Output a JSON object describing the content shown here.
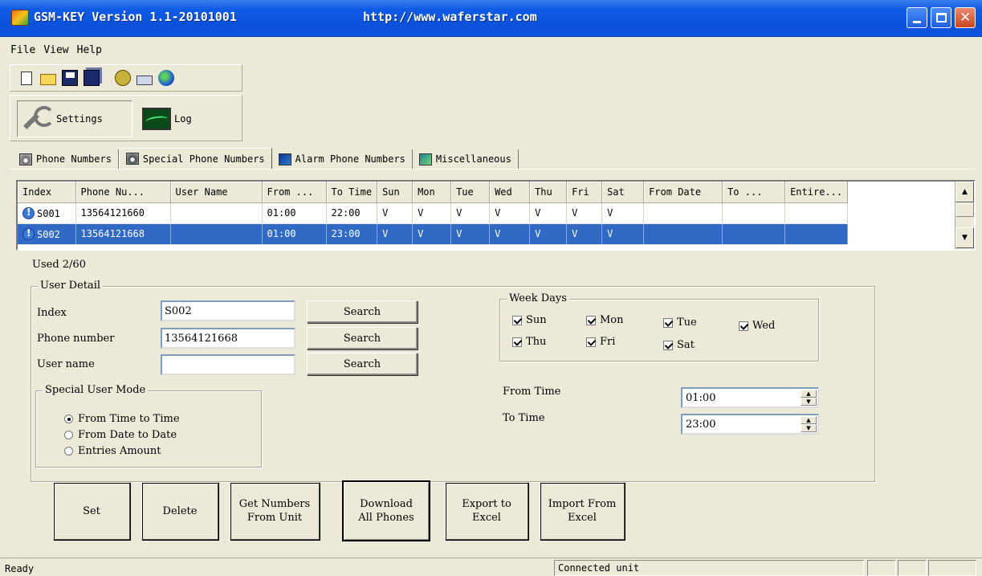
{
  "window": {
    "title": "GSM-KEY Version 1.1-20101001",
    "url": "http://www.waferstar.com"
  },
  "menu": [
    "File",
    "View",
    "Help"
  ],
  "toolbar": {
    "icons": [
      "new-file-icon",
      "open-folder-icon",
      "save-icon",
      "save-all-icon",
      "phone-icon",
      "network-icon",
      "globe-icon"
    ]
  },
  "modes": {
    "settings": "Settings",
    "log": "Log"
  },
  "tabs": [
    {
      "label": "Phone Numbers",
      "active": false
    },
    {
      "label": "Special Phone Numbers",
      "active": true
    },
    {
      "label": "Alarm Phone Numbers",
      "active": false
    },
    {
      "label": "Miscellaneous",
      "active": false
    }
  ],
  "grid": {
    "columns": [
      "Index",
      "Phone Nu...",
      "User Name",
      "From ...",
      "To Time",
      "Sun",
      "Mon",
      "Tue",
      "Wed",
      "Thu",
      "Fri",
      "Sat",
      "From Date",
      "To ...",
      "Entire..."
    ],
    "rows": [
      {
        "cells": [
          "S001",
          "13564121660",
          "",
          "01:00",
          "22:00",
          "V",
          "V",
          "V",
          "V",
          "V",
          "V",
          "V",
          "",
          "",
          ""
        ],
        "selected": false
      },
      {
        "cells": [
          "S002",
          "13564121668",
          "",
          "01:00",
          "23:00",
          "V",
          "V",
          "V",
          "V",
          "V",
          "V",
          "V",
          "",
          "",
          ""
        ],
        "selected": true
      }
    ]
  },
  "used": "Used 2/60",
  "user_detail": {
    "legend": "User Detail",
    "index_label": "Index",
    "index_value": "S002",
    "phone_label": "Phone number",
    "phone_value": "13564121668",
    "username_label": "User name",
    "username_value": "",
    "search_label": "Search"
  },
  "special_mode": {
    "legend": "Special User Mode",
    "options": [
      {
        "label": "From Time to Time",
        "checked": true
      },
      {
        "label": "From Date to Date",
        "checked": false
      },
      {
        "label": "Entries Amount",
        "checked": false
      }
    ]
  },
  "week_days": {
    "legend": "Week Days",
    "days": [
      {
        "label": "Sun",
        "checked": true
      },
      {
        "label": "Mon",
        "checked": true
      },
      {
        "label": "Tue",
        "checked": true
      },
      {
        "label": "Wed",
        "checked": true
      },
      {
        "label": "Thu",
        "checked": true
      },
      {
        "label": "Fri",
        "checked": true
      },
      {
        "label": "Sat",
        "checked": true
      }
    ]
  },
  "time": {
    "from_label": "From Time",
    "from_value": "01:00",
    "to_label": "To Time",
    "to_value": "23:00"
  },
  "actions": {
    "set": "Set",
    "delete": "Delete",
    "get_numbers": [
      "Get Numbers",
      "From Unit"
    ],
    "download": [
      "Download",
      "All Phones"
    ],
    "export": [
      "Export to",
      "Excel"
    ],
    "import": [
      "Import From",
      "Excel"
    ]
  },
  "status": {
    "left": "Ready",
    "middle": "Connected unit"
  },
  "colors": {
    "selection": "#316ac5",
    "titlebar": "#0a50d8"
  }
}
